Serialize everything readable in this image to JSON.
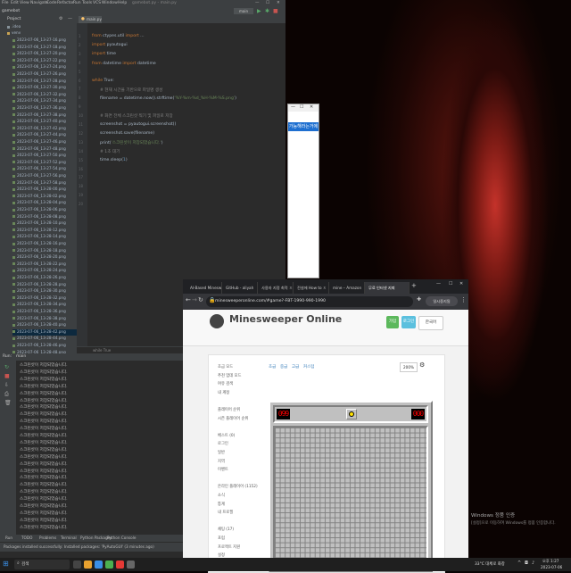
{
  "ide": {
    "title": "gamebot.py - main.py",
    "menu": [
      "File",
      "Edit",
      "View",
      "Navigate",
      "Code",
      "Refactor",
      "Run",
      "Tools",
      "VCS",
      "Window",
      "Help"
    ],
    "project_label": "Project",
    "root": "gamebot",
    "tab": "main.py",
    "line_numbers": [
      "1",
      "2",
      "3",
      "4",
      "5",
      "6",
      "7",
      "8",
      "9",
      "10",
      "11",
      "12",
      "13",
      "14",
      "15",
      "16",
      "17",
      "18",
      "19",
      "20"
    ],
    "files": [
      "2023-07-06_13-27-16.png",
      "2023-07-06_13-27-18.png",
      "2023-07-06_13-27-20.png",
      "2023-07-06_13-27-22.png",
      "2023-07-06_13-27-24.png",
      "2023-07-06_13-27-26.png",
      "2023-07-06_13-27-28.png",
      "2023-07-06_13-27-30.png",
      "2023-07-06_13-27-32.png",
      "2023-07-06_13-27-34.png",
      "2023-07-06_13-27-36.png",
      "2023-07-06_13-27-38.png",
      "2023-07-06_13-27-40.png",
      "2023-07-06_13-27-42.png",
      "2023-07-06_13-27-44.png",
      "2023-07-06_13-27-46.png",
      "2023-07-06_13-27-48.png",
      "2023-07-06_13-27-50.png",
      "2023-07-06_13-27-52.png",
      "2023-07-06_13-27-54.png",
      "2023-07-06_13-27-56.png",
      "2023-07-06_13-27-58.png",
      "2023-07-06_13-28-00.png",
      "2023-07-06_13-28-02.png",
      "2023-07-06_13-28-04.png",
      "2023-07-06_13-28-06.png",
      "2023-07-06_13-28-08.png",
      "2023-07-06_13-28-10.png",
      "2023-07-06_13-28-12.png",
      "2023-07-06_13-28-14.png",
      "2023-07-06_13-28-16.png",
      "2023-07-06_13-28-18.png",
      "2023-07-06_13-28-20.png",
      "2023-07-06_13-28-22.png",
      "2023-07-06_13-28-24.png",
      "2023-07-06_13-28-26.png",
      "2023-07-06_13-28-28.png",
      "2023-07-06_13-28-30.png",
      "2023-07-06_13-28-32.png",
      "2023-07-06_13-28-34.png",
      "2023-07-06_13-28-36.png",
      "2023-07-06_13-28-38.png",
      "2023-07-06_13-28-40.png",
      "2023-07-06_13-28-42.png",
      "2023-07-06_13-28-44.png",
      "2023-07-06_13-28-46.png",
      "2023-07-06_13-28-48.png"
    ],
    "code": {
      "l1a": "from",
      "l1b": " ctypes.util ",
      "l1c": "import",
      "l1d": " ...",
      "l2a": "import",
      "l2b": " pyautogui",
      "l3a": "import",
      "l3b": " time",
      "l4a": "from",
      "l4b": " datetime ",
      "l4c": "import",
      "l4d": " datetime",
      "l6a": "while",
      "l6b": " True:",
      "l7": "# 현재 시간을 기반으로 파일명 생성",
      "l8a": "filename = datetime.now().strftime(",
      "l8b": "'%Y-%m-%d_%H-%M-%S.png'",
      "l8c": ")",
      "l10": "# 화면 전체 스크린샷 찍기 및 파일로 저장",
      "l11": "screenshot = pyautogui.screenshot()",
      "l12": "screenshot.save(filename)",
      "l13a": "print(",
      "l13b": "'스크린샷이 저장되었습니다.'",
      "l13c": ")",
      "l14": "# 1초 대기",
      "l15a": "time.sleep(",
      "l15b": "1",
      "l15c": ")"
    },
    "editor_status": "while True",
    "run_label": "Run:",
    "run_config": "main",
    "console_line": "스크린샷이 저장되었습니다.",
    "bottom_tools": [
      "Run",
      "TODO",
      "Problems",
      "Terminal",
      "Python Packages",
      "Python Console"
    ],
    "status_message": "Packages installed successfully: Installed packages: 'PyAutoGUI' (3 minutes ago)"
  },
  "popup": {
    "text": "가능해라는거에"
  },
  "browser": {
    "tabs": [
      "AI-Based Minesw",
      "GitHub - aliyah",
      "사용자 지정 최적 ㅈ",
      "전설에 How to ㅈ",
      "mine – Amazon",
      "무료 인터넷 지뢰"
    ],
    "url": "minesweeperonline.com/#game?-FBT-1990-990-1990",
    "profile": "일시중지됨"
  },
  "site": {
    "title": "Minesweeper Online",
    "signup": "가입",
    "login": "로그인",
    "lang": "한국어",
    "subtabs": [
      "초급",
      "중급",
      "고급",
      "커스텀"
    ],
    "zoom": "200%",
    "mine_counter": "099",
    "timer": "000",
    "menu": [
      "초급 모드",
      "추천 업데 모드",
      "여유 검색",
      "내 계정",
      "",
      "플레이어 순위",
      "시즌 플레이어 순위",
      "",
      "베스트 (0)",
      "로그인",
      "일반",
      "지역",
      "이벤트",
      "",
      "온라인 플레이어 (1152)",
      "소식",
      "통계",
      "내 프로필",
      "",
      "채팅 (17)",
      "포럼",
      "프로젝트 지원",
      "설정"
    ]
  },
  "windows": {
    "activation_title": "Windows 정품 인증",
    "activation_sub": "[설정]으로 이동하여 Windows를 정품 인증합니다."
  },
  "taskbar": {
    "search": "검색",
    "weather": "33°C 대체로 화창",
    "time": "오후 1:27",
    "date": "2023-07-06"
  },
  "colors": {
    "ide_bg": "#2b2b2b",
    "accent_blue": "#1e6fd0",
    "signup_green": "#5cb85c",
    "login_teal": "#5bc0de"
  }
}
